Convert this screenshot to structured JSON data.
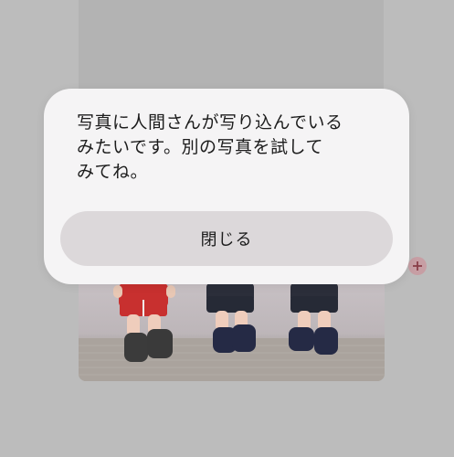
{
  "dialog": {
    "message_lines": [
      "写真に人間さんが写り込んでいる",
      "みたいです。別の写真を試して",
      "みてね。"
    ],
    "close_label": "閉じる"
  },
  "icons": {
    "add_badge": "plus-icon"
  },
  "colors": {
    "dialog_bg": "#f5f4f5",
    "button_bg": "#dcd8da",
    "backdrop": "#bcbcbc",
    "badge": "#c79ea4"
  }
}
